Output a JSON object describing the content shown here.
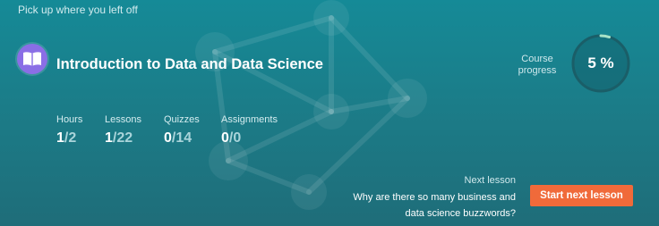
{
  "header": {
    "eyebrow": "Pick up where you left off"
  },
  "course": {
    "icon": "open-book-icon",
    "title": "Introduction to Data and Data Science",
    "progress_label": "Course progress",
    "progress_text": "5 %",
    "progress_value": 0.05
  },
  "stats": [
    {
      "label": "Hours",
      "done": "1",
      "total": "2"
    },
    {
      "label": "Lessons",
      "done": "1",
      "total": "22"
    },
    {
      "label": "Quizzes",
      "done": "0",
      "total": "14"
    },
    {
      "label": "Assignments",
      "done": "0",
      "total": "0"
    }
  ],
  "next_lesson": {
    "label": "Next lesson",
    "title": "Why are there so many business and data science buzzwords?",
    "button_label": "Start next lesson"
  },
  "colors": {
    "accent": "#f06a3a",
    "icon_bg": "#8a6ee6",
    "ring_track": "#1a5e68",
    "ring_fill": "#a7e3c8"
  }
}
